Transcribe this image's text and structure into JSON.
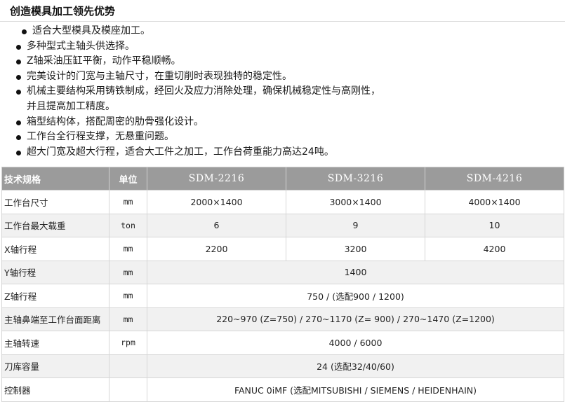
{
  "title": "创造模具加工领先优势",
  "features": [
    "适合大型模具及模座加工。",
    "多种型式主轴头供选择。",
    "Z轴采油压缸平衡，动作平稳顺畅。",
    "完美设计的门宽与主轴尺寸，在重切削时表现独特的稳定性。",
    "机械主要结构采用铸铁制成，经回火及应力消除处理，确保机械稳定性与高刚性，",
    "并且提高加工精度。",
    "箱型结构体，搭配周密的肋骨强化设计。",
    "工作台全行程支撑，无悬重问题。",
    "超大门宽及超大行程，适合大工件之加工，工作台荷重能力高达24吨。"
  ],
  "table": {
    "headers": [
      "技术规格",
      "单位",
      "SDM-2216",
      "SDM-3216",
      "SDM-4216"
    ],
    "rows": [
      {
        "name": "工作台尺寸",
        "unit": "mm",
        "values": [
          "2000×1400",
          "3000×1400",
          "4000×1400"
        ]
      },
      {
        "name": "工作台最大载重",
        "unit": "ton",
        "values": [
          "6",
          "9",
          "10"
        ]
      },
      {
        "name": "X轴行程",
        "unit": "mm",
        "values": [
          "2200",
          "3200",
          "4200"
        ]
      },
      {
        "name": "Y轴行程",
        "unit": "mm",
        "values": [
          "1400"
        ]
      },
      {
        "name": "Z轴行程",
        "unit": "mm",
        "values": [
          "750 / (选配900 / 1200)"
        ]
      },
      {
        "name": "主轴鼻端至工作台面距离",
        "unit": "mm",
        "values": [
          "220~970 (Z=750) / 270~1170 (Z= 900) / 270~1470 (Z=1200)"
        ]
      },
      {
        "name": "主轴转速",
        "unit": "rpm",
        "values": [
          "4000 / 6000"
        ]
      },
      {
        "name": "刀库容量",
        "unit": "",
        "values": [
          "24 (选配32/40/60)"
        ]
      },
      {
        "name": "控制器",
        "unit": "",
        "values": [
          "FANUC 0iMF (选配MITSUBISHI / SIEMENS / HEIDENHAIN)"
        ]
      }
    ]
  }
}
